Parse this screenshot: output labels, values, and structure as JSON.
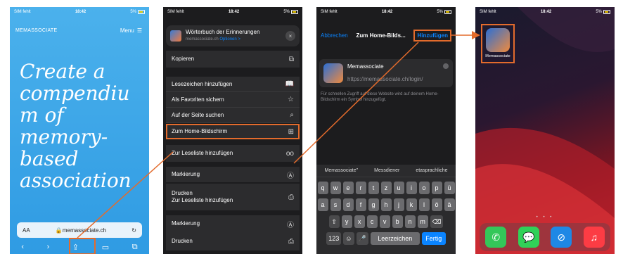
{
  "caption": "",
  "colors": {
    "highlight": "#e36b2c",
    "link": "#0a84ff",
    "sky": "#3aa5ea"
  },
  "status": {
    "carrier": "SIM fehlt",
    "time": "18:42",
    "battery": "5%"
  },
  "phone1": {
    "logo": "MEMASSOCIATE",
    "menu": "Menu",
    "hero": "Create a compendiu m of memory-based association",
    "url_aa": "AA",
    "url": "memassociate.ch",
    "reload": "C"
  },
  "phone2": {
    "sheet_title": "Wörterbuch der Erinnerungen",
    "sheet_domain": "memassociate.ch",
    "sheet_options": "Optionen >",
    "close": "×",
    "actions": [
      {
        "label": "Kopieren",
        "icon": "copy-icon",
        "glyph": "⧉"
      },
      {
        "label": "Lesezeichen hinzufügen",
        "icon": "book-icon",
        "glyph": "📖"
      },
      {
        "label": "Als Favoriten sichern",
        "icon": "star-icon",
        "glyph": "☆"
      },
      {
        "label": "Auf der Seite suchen",
        "icon": "search-icon",
        "glyph": "⌕"
      },
      {
        "label": "Zum Home-Bildschirm",
        "icon": "add-square-icon",
        "glyph": "⊞"
      },
      {
        "label": "Zur Leseliste hinzufügen",
        "icon": "glasses-icon",
        "glyph": "oo"
      },
      {
        "label": "Markierung",
        "icon": "markup-icon",
        "glyph": "Ⓐ"
      },
      {
        "label": "Drucken\nZur Leseliste hinzufügen",
        "icon": "print-icon",
        "glyph": "⎙"
      },
      {
        "label": "Markierung",
        "icon": "markup-icon",
        "glyph": "Ⓐ"
      },
      {
        "label": "Drucken",
        "icon": "print-icon",
        "glyph": "⎙"
      }
    ]
  },
  "phone3": {
    "cancel": "Abbrechen",
    "title": "Zum Home-Bilds...",
    "add": "Hinzufügen",
    "app_name": "Memassociate",
    "app_url": "https://memassociate.ch/login/",
    "note": "Für schnellen Zugriff auf diese Website wird auf deinem Home-Bildschirm ein Symbol hinzugefügt.",
    "suggestions": [
      "Memassociate\"",
      "Messdiener",
      "etasprachliche"
    ],
    "row1": [
      "q",
      "w",
      "e",
      "r",
      "t",
      "z",
      "u",
      "i",
      "o",
      "p",
      "ü"
    ],
    "row2": [
      "a",
      "s",
      "d",
      "f",
      "g",
      "h",
      "j",
      "k",
      "l",
      "ö",
      "ä"
    ],
    "row3": [
      "⇧",
      "y",
      "x",
      "c",
      "v",
      "b",
      "n",
      "m",
      "⌫"
    ],
    "row4": [
      "123",
      "☺",
      "🎤",
      "Leerzeichen",
      "Fertig"
    ]
  },
  "phone4": {
    "app_label": "Memassociate",
    "page_dots": "• • •",
    "dock": [
      {
        "icon": "phone-icon",
        "glyph": "✆",
        "color": "#34c759"
      },
      {
        "icon": "messages-icon",
        "glyph": "💬",
        "color": "#30d158"
      },
      {
        "icon": "safari-icon",
        "glyph": "⊘",
        "color": "#1e88e5"
      },
      {
        "icon": "music-icon",
        "glyph": "♫",
        "color": "#fc3c44"
      }
    ]
  }
}
